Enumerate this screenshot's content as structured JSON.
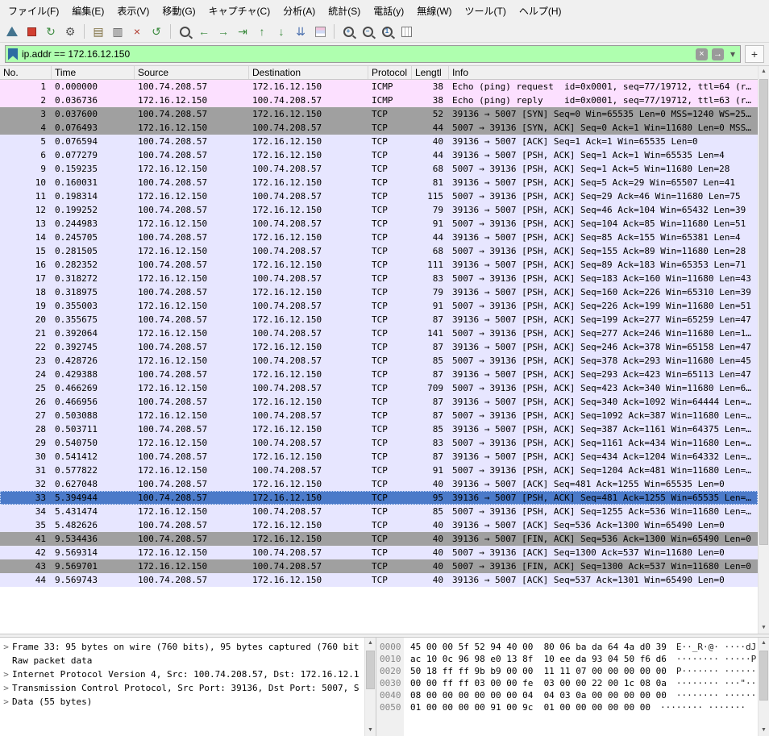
{
  "colors": {
    "icmp_row": "#fce0ff",
    "tcp_row": "#e7e6ff",
    "tcp_synfin_row": "#a0a0a0",
    "selected_row": "#4b7ac9",
    "filter_valid_bg": "#afffaf"
  },
  "menu": {
    "items": [
      {
        "id": "file",
        "label": "ファイル(F)"
      },
      {
        "id": "edit",
        "label": "編集(E)"
      },
      {
        "id": "view",
        "label": "表示(V)"
      },
      {
        "id": "go",
        "label": "移動(G)"
      },
      {
        "id": "capture",
        "label": "キャプチャ(C)"
      },
      {
        "id": "analyze",
        "label": "分析(A)"
      },
      {
        "id": "statistics",
        "label": "統計(S)"
      },
      {
        "id": "telephony",
        "label": "電話(y)"
      },
      {
        "id": "wireless",
        "label": "無線(W)"
      },
      {
        "id": "tools",
        "label": "ツール(T)"
      },
      {
        "id": "help",
        "label": "ヘルプ(H)"
      }
    ]
  },
  "toolbar": {
    "items": [
      {
        "name": "start-capture-icon",
        "cls": "fin"
      },
      {
        "name": "stop-capture-icon",
        "cls": "stopsq"
      },
      {
        "name": "restart-capture-icon",
        "glyph": "↻",
        "color": "#3d8b40"
      },
      {
        "name": "capture-options-icon",
        "glyph": "⚙",
        "color": "#555555"
      },
      {
        "sep": true
      },
      {
        "name": "open-file-icon",
        "glyph": "▤",
        "color": "#7a6a3a"
      },
      {
        "name": "save-file-icon",
        "glyph": "▥",
        "color": "#555555"
      },
      {
        "name": "close-file-icon",
        "glyph": "×",
        "color": "#b03a2e"
      },
      {
        "name": "reload-file-icon",
        "glyph": "↺",
        "color": "#3d8b40"
      },
      {
        "sep": true
      },
      {
        "name": "find-packet-icon",
        "cls": "mag"
      },
      {
        "name": "go-back-icon",
        "glyph": "←",
        "color": "#3d8b40"
      },
      {
        "name": "go-forward-icon",
        "glyph": "→",
        "color": "#3d8b40"
      },
      {
        "name": "go-to-packet-icon",
        "glyph": "⇥",
        "color": "#3d8b40"
      },
      {
        "name": "first-packet-icon",
        "glyph": "↑",
        "color": "#3d8b40"
      },
      {
        "name": "last-packet-icon",
        "glyph": "↓",
        "color": "#3d8b40"
      },
      {
        "name": "auto-scroll-icon",
        "glyph": "⇊",
        "color": "#4a6fae"
      },
      {
        "name": "colorize-icon",
        "cls": "colorbars"
      },
      {
        "sep": true
      },
      {
        "name": "zoom-in-icon",
        "cls": "mag",
        "inner": "+"
      },
      {
        "name": "zoom-out-icon",
        "cls": "mag",
        "inner": "−"
      },
      {
        "name": "zoom-100-icon",
        "cls": "mag",
        "inner": "1"
      },
      {
        "name": "resize-columns-icon",
        "cls": "cols"
      }
    ]
  },
  "filter": {
    "value": "ip.addr == 172.16.12.150",
    "clear_glyph": "×",
    "apply_glyph": "→",
    "dropdown_glyph": "▾",
    "plus_glyph": "+"
  },
  "packet_list": {
    "columns": [
      {
        "id": "no",
        "label": "No."
      },
      {
        "id": "time",
        "label": "Time"
      },
      {
        "id": "source",
        "label": "Source"
      },
      {
        "id": "destination",
        "label": "Destination"
      },
      {
        "id": "protocol",
        "label": "Protocol"
      },
      {
        "id": "length",
        "label": "Lengtl"
      },
      {
        "id": "info",
        "label": "Info"
      }
    ],
    "rows": [
      {
        "no": "1",
        "time": "0.000000",
        "src": "100.74.208.57",
        "dst": "172.16.12.150",
        "proto": "ICMP",
        "len": "38",
        "info": "Echo (ping) request  id=0x0001, seq=77/19712, ttl=64 (r…",
        "style": "icmp"
      },
      {
        "no": "2",
        "time": "0.036736",
        "src": "172.16.12.150",
        "dst": "100.74.208.57",
        "proto": "ICMP",
        "len": "38",
        "info": "Echo (ping) reply    id=0x0001, seq=77/19712, ttl=63 (r…",
        "style": "icmp"
      },
      {
        "no": "3",
        "time": "0.037600",
        "src": "100.74.208.57",
        "dst": "172.16.12.150",
        "proto": "TCP",
        "len": "52",
        "info": "39136 → 5007 [SYN] Seq=0 Win=65535 Len=0 MSS=1240 WS=25…",
        "style": "gray"
      },
      {
        "no": "4",
        "time": "0.076493",
        "src": "172.16.12.150",
        "dst": "100.74.208.57",
        "proto": "TCP",
        "len": "44",
        "info": "5007 → 39136 [SYN, ACK] Seq=0 Ack=1 Win=11680 Len=0 MSS…",
        "style": "gray"
      },
      {
        "no": "5",
        "time": "0.076594",
        "src": "100.74.208.57",
        "dst": "172.16.12.150",
        "proto": "TCP",
        "len": "40",
        "info": "39136 → 5007 [ACK] Seq=1 Ack=1 Win=65535 Len=0",
        "style": "tcp"
      },
      {
        "no": "6",
        "time": "0.077279",
        "src": "100.74.208.57",
        "dst": "172.16.12.150",
        "proto": "TCP",
        "len": "44",
        "info": "39136 → 5007 [PSH, ACK] Seq=1 Ack=1 Win=65535 Len=4",
        "style": "tcp"
      },
      {
        "no": "9",
        "time": "0.159235",
        "src": "172.16.12.150",
        "dst": "100.74.208.57",
        "proto": "TCP",
        "len": "68",
        "info": "5007 → 39136 [PSH, ACK] Seq=1 Ack=5 Win=11680 Len=28",
        "style": "tcp"
      },
      {
        "no": "10",
        "time": "0.160031",
        "src": "100.74.208.57",
        "dst": "172.16.12.150",
        "proto": "TCP",
        "len": "81",
        "info": "39136 → 5007 [PSH, ACK] Seq=5 Ack=29 Win=65507 Len=41",
        "style": "tcp"
      },
      {
        "no": "11",
        "time": "0.198314",
        "src": "172.16.12.150",
        "dst": "100.74.208.57",
        "proto": "TCP",
        "len": "115",
        "info": "5007 → 39136 [PSH, ACK] Seq=29 Ack=46 Win=11680 Len=75",
        "style": "tcp"
      },
      {
        "no": "12",
        "time": "0.199252",
        "src": "100.74.208.57",
        "dst": "172.16.12.150",
        "proto": "TCP",
        "len": "79",
        "info": "39136 → 5007 [PSH, ACK] Seq=46 Ack=104 Win=65432 Len=39",
        "style": "tcp"
      },
      {
        "no": "13",
        "time": "0.244983",
        "src": "172.16.12.150",
        "dst": "100.74.208.57",
        "proto": "TCP",
        "len": "91",
        "info": "5007 → 39136 [PSH, ACK] Seq=104 Ack=85 Win=11680 Len=51",
        "style": "tcp"
      },
      {
        "no": "14",
        "time": "0.245705",
        "src": "100.74.208.57",
        "dst": "172.16.12.150",
        "proto": "TCP",
        "len": "44",
        "info": "39136 → 5007 [PSH, ACK] Seq=85 Ack=155 Win=65381 Len=4",
        "style": "tcp"
      },
      {
        "no": "15",
        "time": "0.281505",
        "src": "172.16.12.150",
        "dst": "100.74.208.57",
        "proto": "TCP",
        "len": "68",
        "info": "5007 → 39136 [PSH, ACK] Seq=155 Ack=89 Win=11680 Len=28",
        "style": "tcp"
      },
      {
        "no": "16",
        "time": "0.282352",
        "src": "100.74.208.57",
        "dst": "172.16.12.150",
        "proto": "TCP",
        "len": "111",
        "info": "39136 → 5007 [PSH, ACK] Seq=89 Ack=183 Win=65353 Len=71",
        "style": "tcp"
      },
      {
        "no": "17",
        "time": "0.318272",
        "src": "172.16.12.150",
        "dst": "100.74.208.57",
        "proto": "TCP",
        "len": "83",
        "info": "5007 → 39136 [PSH, ACK] Seq=183 Ack=160 Win=11680 Len=43",
        "style": "tcp"
      },
      {
        "no": "18",
        "time": "0.318975",
        "src": "100.74.208.57",
        "dst": "172.16.12.150",
        "proto": "TCP",
        "len": "79",
        "info": "39136 → 5007 [PSH, ACK] Seq=160 Ack=226 Win=65310 Len=39",
        "style": "tcp"
      },
      {
        "no": "19",
        "time": "0.355003",
        "src": "172.16.12.150",
        "dst": "100.74.208.57",
        "proto": "TCP",
        "len": "91",
        "info": "5007 → 39136 [PSH, ACK] Seq=226 Ack=199 Win=11680 Len=51",
        "style": "tcp"
      },
      {
        "no": "20",
        "time": "0.355675",
        "src": "100.74.208.57",
        "dst": "172.16.12.150",
        "proto": "TCP",
        "len": "87",
        "info": "39136 → 5007 [PSH, ACK] Seq=199 Ack=277 Win=65259 Len=47",
        "style": "tcp"
      },
      {
        "no": "21",
        "time": "0.392064",
        "src": "172.16.12.150",
        "dst": "100.74.208.57",
        "proto": "TCP",
        "len": "141",
        "info": "5007 → 39136 [PSH, ACK] Seq=277 Ack=246 Win=11680 Len=1…",
        "style": "tcp"
      },
      {
        "no": "22",
        "time": "0.392745",
        "src": "100.74.208.57",
        "dst": "172.16.12.150",
        "proto": "TCP",
        "len": "87",
        "info": "39136 → 5007 [PSH, ACK] Seq=246 Ack=378 Win=65158 Len=47",
        "style": "tcp"
      },
      {
        "no": "23",
        "time": "0.428726",
        "src": "172.16.12.150",
        "dst": "100.74.208.57",
        "proto": "TCP",
        "len": "85",
        "info": "5007 → 39136 [PSH, ACK] Seq=378 Ack=293 Win=11680 Len=45",
        "style": "tcp"
      },
      {
        "no": "24",
        "time": "0.429388",
        "src": "100.74.208.57",
        "dst": "172.16.12.150",
        "proto": "TCP",
        "len": "87",
        "info": "39136 → 5007 [PSH, ACK] Seq=293 Ack=423 Win=65113 Len=47",
        "style": "tcp"
      },
      {
        "no": "25",
        "time": "0.466269",
        "src": "172.16.12.150",
        "dst": "100.74.208.57",
        "proto": "TCP",
        "len": "709",
        "info": "5007 → 39136 [PSH, ACK] Seq=423 Ack=340 Win=11680 Len=6…",
        "style": "tcp"
      },
      {
        "no": "26",
        "time": "0.466956",
        "src": "100.74.208.57",
        "dst": "172.16.12.150",
        "proto": "TCP",
        "len": "87",
        "info": "39136 → 5007 [PSH, ACK] Seq=340 Ack=1092 Win=64444 Len=…",
        "style": "tcp"
      },
      {
        "no": "27",
        "time": "0.503088",
        "src": "172.16.12.150",
        "dst": "100.74.208.57",
        "proto": "TCP",
        "len": "87",
        "info": "5007 → 39136 [PSH, ACK] Seq=1092 Ack=387 Win=11680 Len=…",
        "style": "tcp"
      },
      {
        "no": "28",
        "time": "0.503711",
        "src": "100.74.208.57",
        "dst": "172.16.12.150",
        "proto": "TCP",
        "len": "85",
        "info": "39136 → 5007 [PSH, ACK] Seq=387 Ack=1161 Win=64375 Len=…",
        "style": "tcp"
      },
      {
        "no": "29",
        "time": "0.540750",
        "src": "172.16.12.150",
        "dst": "100.74.208.57",
        "proto": "TCP",
        "len": "83",
        "info": "5007 → 39136 [PSH, ACK] Seq=1161 Ack=434 Win=11680 Len=…",
        "style": "tcp"
      },
      {
        "no": "30",
        "time": "0.541412",
        "src": "100.74.208.57",
        "dst": "172.16.12.150",
        "proto": "TCP",
        "len": "87",
        "info": "39136 → 5007 [PSH, ACK] Seq=434 Ack=1204 Win=64332 Len=…",
        "style": "tcp"
      },
      {
        "no": "31",
        "time": "0.577822",
        "src": "172.16.12.150",
        "dst": "100.74.208.57",
        "proto": "TCP",
        "len": "91",
        "info": "5007 → 39136 [PSH, ACK] Seq=1204 Ack=481 Win=11680 Len=…",
        "style": "tcp"
      },
      {
        "no": "32",
        "time": "0.627048",
        "src": "100.74.208.57",
        "dst": "172.16.12.150",
        "proto": "TCP",
        "len": "40",
        "info": "39136 → 5007 [ACK] Seq=481 Ack=1255 Win=65535 Len=0",
        "style": "tcp"
      },
      {
        "no": "33",
        "time": "5.394944",
        "src": "100.74.208.57",
        "dst": "172.16.12.150",
        "proto": "TCP",
        "len": "95",
        "info": "39136 → 5007 [PSH, ACK] Seq=481 Ack=1255 Win=65535 Len=…",
        "style": "sel"
      },
      {
        "no": "34",
        "time": "5.431474",
        "src": "172.16.12.150",
        "dst": "100.74.208.57",
        "proto": "TCP",
        "len": "85",
        "info": "5007 → 39136 [PSH, ACK] Seq=1255 Ack=536 Win=11680 Len=…",
        "style": "tcp"
      },
      {
        "no": "35",
        "time": "5.482626",
        "src": "100.74.208.57",
        "dst": "172.16.12.150",
        "proto": "TCP",
        "len": "40",
        "info": "39136 → 5007 [ACK] Seq=536 Ack=1300 Win=65490 Len=0",
        "style": "tcp"
      },
      {
        "no": "41",
        "time": "9.534436",
        "src": "100.74.208.57",
        "dst": "172.16.12.150",
        "proto": "TCP",
        "len": "40",
        "info": "39136 → 5007 [FIN, ACK] Seq=536 Ack=1300 Win=65490 Len=0",
        "style": "gray"
      },
      {
        "no": "42",
        "time": "9.569314",
        "src": "172.16.12.150",
        "dst": "100.74.208.57",
        "proto": "TCP",
        "len": "40",
        "info": "5007 → 39136 [ACK] Seq=1300 Ack=537 Win=11680 Len=0",
        "style": "tcp"
      },
      {
        "no": "43",
        "time": "9.569701",
        "src": "172.16.12.150",
        "dst": "100.74.208.57",
        "proto": "TCP",
        "len": "40",
        "info": "5007 → 39136 [FIN, ACK] Seq=1300 Ack=537 Win=11680 Len=0",
        "style": "gray"
      },
      {
        "no": "44",
        "time": "9.569743",
        "src": "100.74.208.57",
        "dst": "172.16.12.150",
        "proto": "TCP",
        "len": "40",
        "info": "39136 → 5007 [ACK] Seq=537 Ack=1301 Win=65490 Len=0",
        "style": "tcp"
      }
    ]
  },
  "detail": {
    "expander_glyph": ">",
    "lines": [
      {
        "expandable": true,
        "text": "Frame 33: 95 bytes on wire (760 bits), 95 bytes captured (760 bit"
      },
      {
        "expandable": false,
        "text": "Raw packet data"
      },
      {
        "expandable": true,
        "text": "Internet Protocol Version 4, Src: 100.74.208.57, Dst: 172.16.12.1"
      },
      {
        "expandable": true,
        "text": "Transmission Control Protocol, Src Port: 39136, Dst Port: 5007, S"
      },
      {
        "expandable": true,
        "text": "Data (55 bytes)"
      }
    ]
  },
  "hex": {
    "rows": [
      {
        "offset": "0000",
        "bytes": "45 00 00 5f 52 94 40 00  80 06 ba da 64 4a d0 39",
        "ascii": "E··_R·@· ····dJ·9"
      },
      {
        "offset": "0010",
        "bytes": "ac 10 0c 96 98 e0 13 8f  10 ee da 93 04 50 f6 d6",
        "ascii": "········ ·····P··"
      },
      {
        "offset": "0020",
        "bytes": "50 18 ff ff 9b b9 00 00  11 11 07 00 00 00 00 00",
        "ascii": "P······· ········"
      },
      {
        "offset": "0030",
        "bytes": "00 00 ff ff 03 00 00 fe  03 00 00 22 00 1c 08 0a",
        "ascii": "········ ···\"····"
      },
      {
        "offset": "0040",
        "bytes": "08 00 00 00 00 00 00 04  04 03 0a 00 00 00 00 00",
        "ascii": "········ ········"
      },
      {
        "offset": "0050",
        "bytes": "01 00 00 00 00 91 00 9c  01 00 00 00 00 00 00",
        "ascii": "········ ·······"
      }
    ]
  }
}
